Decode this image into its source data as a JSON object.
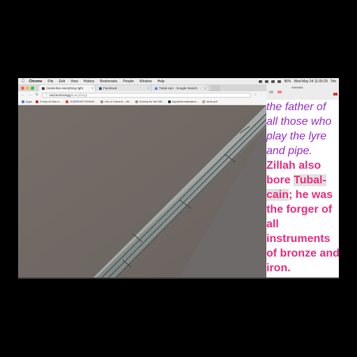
{
  "menubar": {
    "app": "Chrome",
    "menus": [
      "File",
      "Edit",
      "View",
      "History",
      "Bookmarks",
      "People",
      "Window",
      "Help"
    ],
    "battery": "96%",
    "datetime": "Wed May 24  11:05:29",
    "user": "Tob"
  },
  "tabs": [
    {
      "label": "i kinda like everything right",
      "color": "#444444"
    },
    {
      "label": "Facebook",
      "color": "#3b5998"
    },
    {
      "label": "Tubal-cain - Google Search",
      "color": "#4285f4"
    }
  ],
  "omnibox": {
    "host": "void.technology",
    "path": "/everything/"
  },
  "bookmarks": [
    {
      "label": "Apps",
      "color": "#5a7fd6"
    },
    {
      "label": "Trump At Mar-a-...",
      "color": "#c0392b"
    },
    {
      "label": "STARSHIP DENUE...",
      "color": "#e74c3c"
    },
    {
      "label": "I Am a Camera – Wi...",
      "color": "#999999"
    },
    {
      "label": "Society for the Diff...",
      "color": "#999999"
    },
    {
      "label": "HyperNormalisation...",
      "color": "#2c3e50"
    },
    {
      "label": "tarse.pdf",
      "color": "#aaaaaa"
    }
  ],
  "document": {
    "tab": "Genesis",
    "lines": [
      {
        "parts": [
          {
            "text": "the father of",
            "style": "purple"
          }
        ]
      },
      {
        "parts": [
          {
            "text": "all those who",
            "style": "purple"
          }
        ]
      },
      {
        "parts": [
          {
            "text": "play the lyre",
            "style": "purple"
          }
        ]
      },
      {
        "parts": [
          {
            "text": "and pipe.",
            "style": "purple"
          }
        ]
      },
      {
        "parts": [
          {
            "text": "Zillah also",
            "style": "pink"
          }
        ]
      },
      {
        "parts": [
          {
            "text": "bore ",
            "style": "pink"
          },
          {
            "text": "Tubal-",
            "style": "pink hl"
          }
        ]
      },
      {
        "parts": [
          {
            "text": "cain",
            "style": "pink hl"
          },
          {
            "text": "; he was",
            "style": "pink"
          }
        ]
      },
      {
        "parts": [
          {
            "text": "the forger of",
            "style": "pink"
          }
        ]
      },
      {
        "parts": [
          {
            "text": "all",
            "style": "pink"
          }
        ]
      },
      {
        "parts": [
          {
            "text": "instruments",
            "style": "pink"
          }
        ]
      },
      {
        "parts": [
          {
            "text": "of bronze and",
            "style": "pink"
          }
        ]
      },
      {
        "parts": [
          {
            "text": "iron.",
            "style": "pink"
          }
        ]
      }
    ]
  }
}
